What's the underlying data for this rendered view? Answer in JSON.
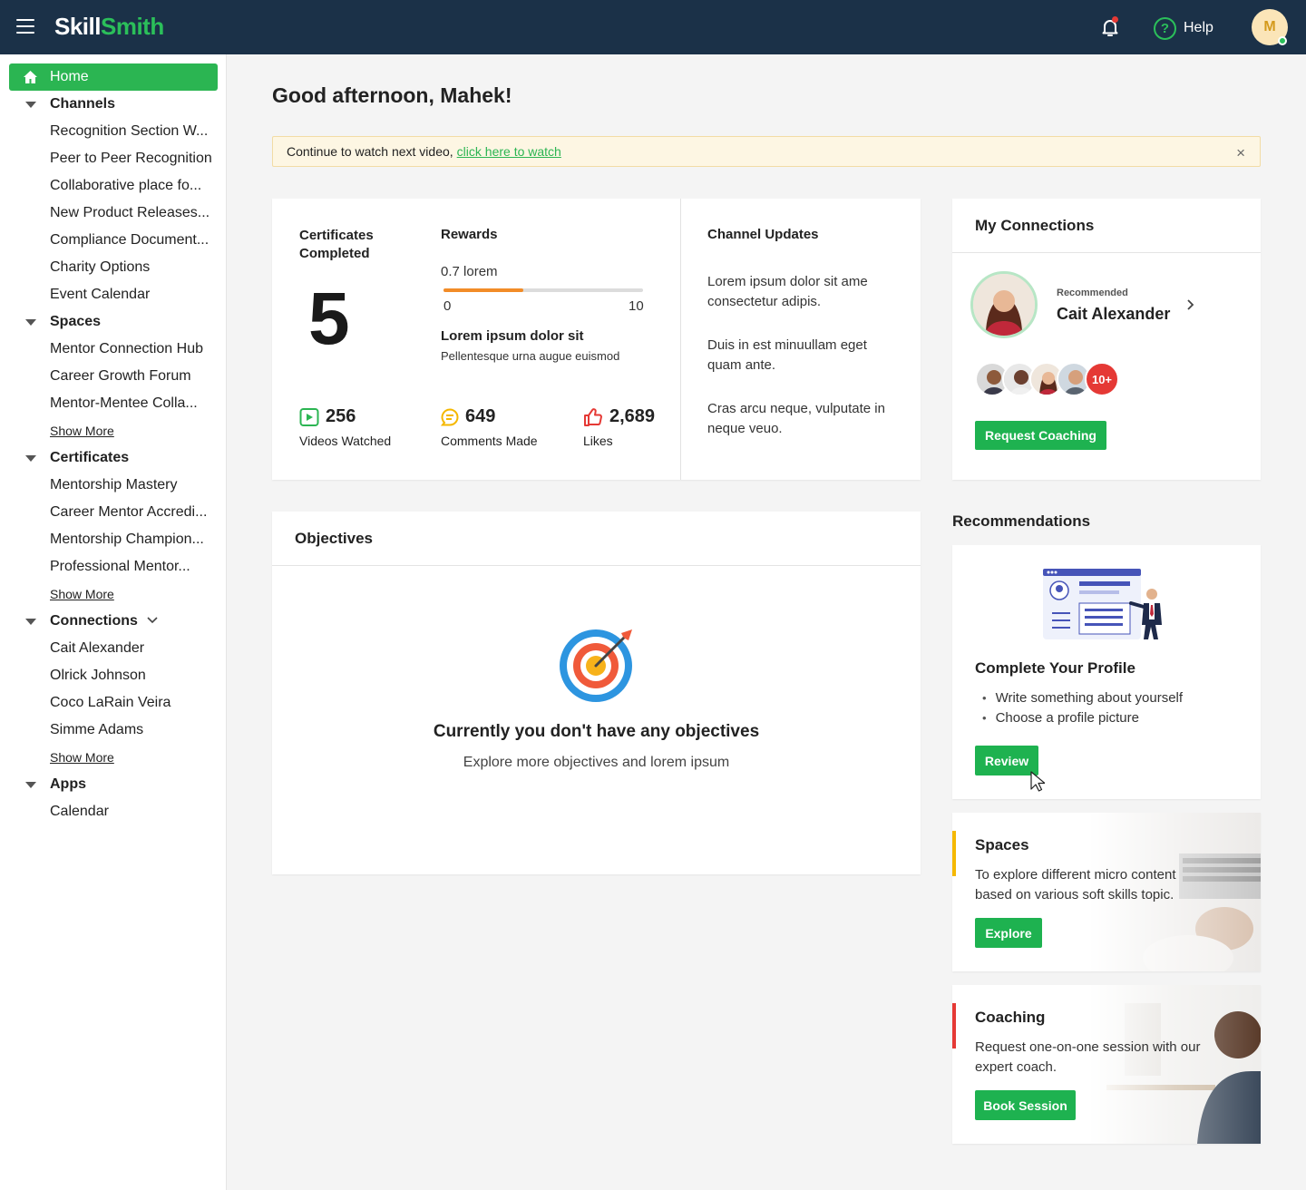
{
  "header": {
    "logo_part1": "Skill",
    "logo_part2": "Smith",
    "help_label": "Help",
    "avatar_initial": "M"
  },
  "sidebar": {
    "home": "Home",
    "channels": {
      "title": "Channels",
      "items": [
        "Recognition Section W...",
        "Peer to Peer Recognition",
        "Collaborative place fo...",
        "New Product Releases...",
        "Compliance Document...",
        "Charity Options",
        "Event Calendar"
      ]
    },
    "spaces": {
      "title": "Spaces",
      "items": [
        "Mentor Connection Hub",
        "Career Growth Forum",
        "Mentor-Mentee Colla..."
      ],
      "show_more": "Show More"
    },
    "certificates": {
      "title": "Certificates",
      "items": [
        "Mentorship Mastery",
        "Career Mentor Accredi...",
        "Mentorship Champion...",
        "Professional Mentor..."
      ],
      "show_more": "Show More"
    },
    "connections": {
      "title": "Connections",
      "items": [
        "Cait Alexander",
        "Olrick Johnson",
        "Coco LaRain Veira",
        "Simme Adams"
      ],
      "show_more": "Show More"
    },
    "apps": {
      "title": "Apps",
      "items": [
        "Calendar"
      ]
    }
  },
  "main": {
    "greeting": "Good afternoon, Mahek!",
    "banner": {
      "text": "Continue to watch next video,",
      "link": "click here to watch",
      "close": "×"
    },
    "stats": {
      "cert_label": "Certificates Completed",
      "cert_value": "5",
      "rewards_label": "Rewards",
      "reward_value": "0.7 lorem",
      "reward_progress": 0.4,
      "reward_min": "0",
      "reward_max": "10",
      "reward_title": "Lorem ipsum dolor sit",
      "reward_sub": "Pellentesque urna augue euismod",
      "videos_value": "256",
      "videos_label": "Videos Watched",
      "comments_value": "649",
      "comments_label": "Comments Made",
      "likes_value": "2,689",
      "likes_label": "Likes"
    },
    "channel_updates": {
      "title": "Channel Updates",
      "items": [
        "Lorem ipsum dolor sit ame consectetur adipis.",
        "Duis in est minuullam eget quam ante.",
        "Cras arcu neque, vulputate in neque veuo."
      ]
    },
    "objectives": {
      "title": "Objectives",
      "empty_title": "Currently you don't have any objectives",
      "empty_sub": "Explore more objectives and lorem ipsum"
    }
  },
  "right": {
    "connections": {
      "title": "My Connections",
      "recommended_label": "Recommended",
      "recommended_name": "Cait Alexander",
      "more_badge": "10+",
      "button": "Request Coaching"
    },
    "recommendations_heading": "Recommendations",
    "profile": {
      "title": "Complete Your Profile",
      "bullets": [
        "Write something about yourself",
        "Choose a profile picture"
      ],
      "button": "Review"
    },
    "spaces": {
      "title": "Spaces",
      "text": "To explore different micro content based on various soft skills topic.",
      "button": "Explore",
      "accent": "#f5b800"
    },
    "coaching": {
      "title": "Coaching",
      "text": "Request one-on-one session with our expert coach.",
      "button": "Book Session",
      "accent": "#e53935"
    }
  }
}
